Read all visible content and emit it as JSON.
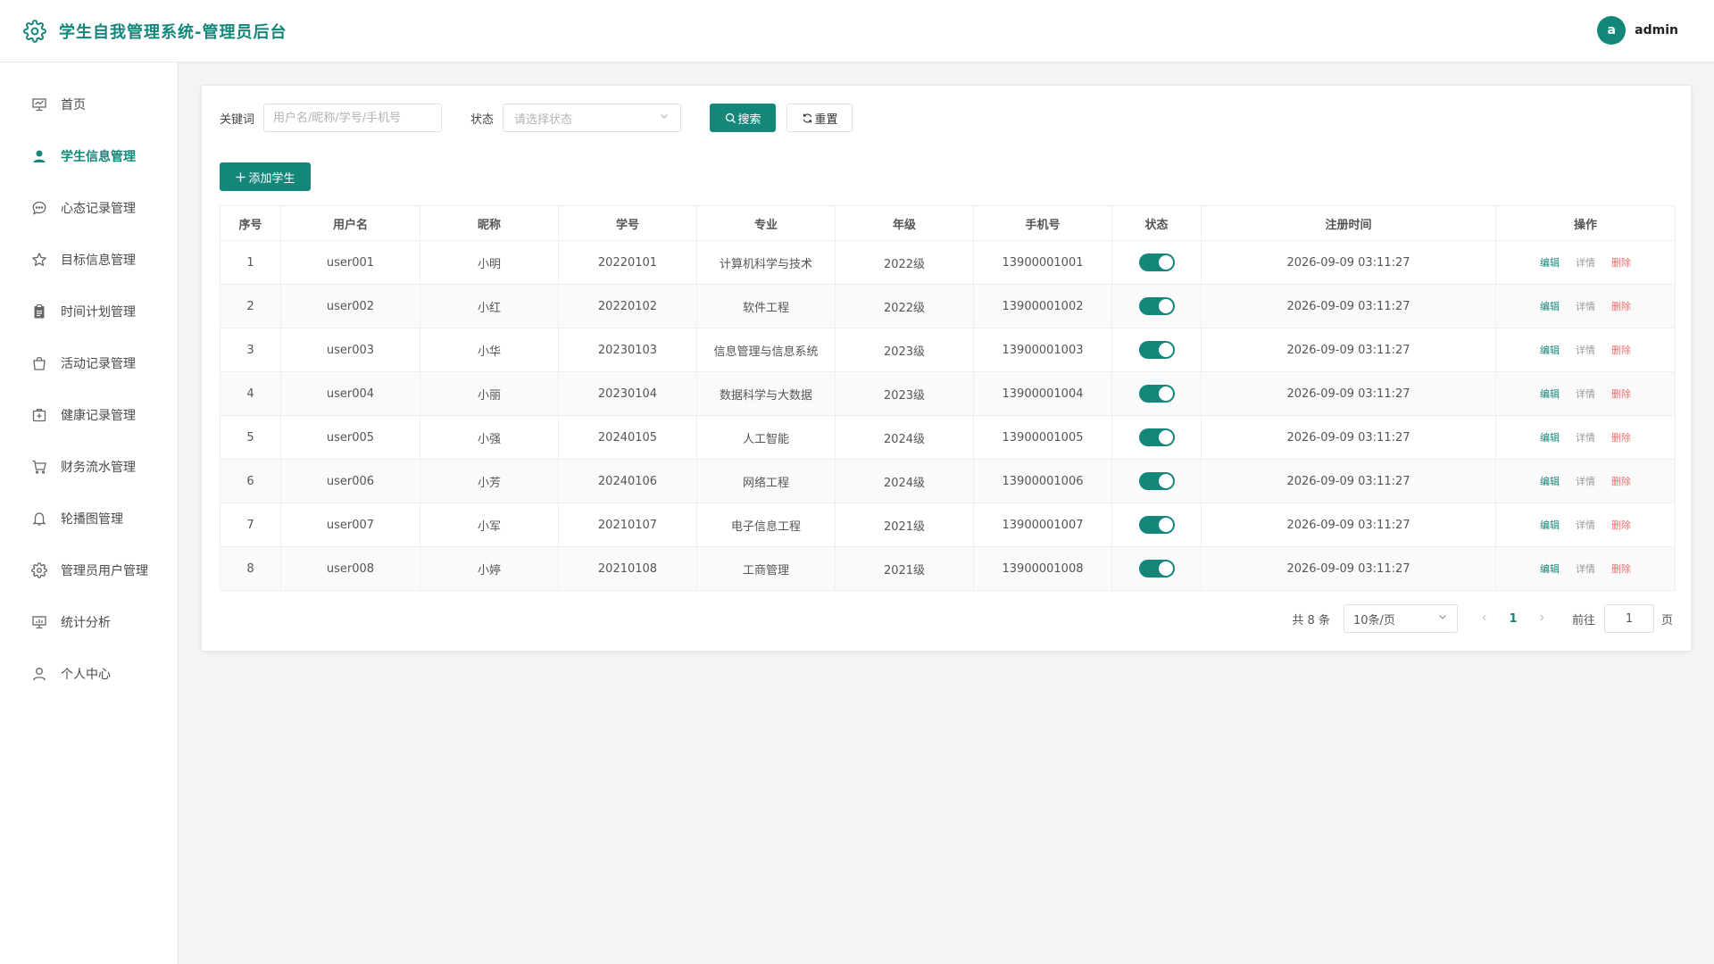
{
  "app": {
    "title": "学生自我管理系统-管理员后台",
    "brand_color": "#14877a"
  },
  "user": {
    "avatar_letter": "a",
    "name": "admin"
  },
  "sidebar": {
    "items": [
      {
        "label": "首页",
        "icon": "presentation-board-icon",
        "active": false
      },
      {
        "label": "学生信息管理",
        "icon": "user-icon",
        "active": true
      },
      {
        "label": "心态记录管理",
        "icon": "chat-bubble-icon",
        "active": false
      },
      {
        "label": "目标信息管理",
        "icon": "star-icon",
        "active": false
      },
      {
        "label": "时间计划管理",
        "icon": "clipboard-icon",
        "active": false
      },
      {
        "label": "活动记录管理",
        "icon": "shopping-bag-icon",
        "active": false
      },
      {
        "label": "健康记录管理",
        "icon": "first-aid-kit-icon",
        "active": false
      },
      {
        "label": "财务流水管理",
        "icon": "shopping-cart-icon",
        "active": false
      },
      {
        "label": "轮播图管理",
        "icon": "bell-icon",
        "active": false
      },
      {
        "label": "管理员用户管理",
        "icon": "gear-icon",
        "active": false
      },
      {
        "label": "统计分析",
        "icon": "chart-board-icon",
        "active": false
      },
      {
        "label": "个人中心",
        "icon": "user-outline-icon",
        "active": false
      }
    ]
  },
  "filters": {
    "keyword_label": "关键词",
    "keyword_placeholder": "用户名/昵称/学号/手机号",
    "status_label": "状态",
    "status_placeholder": "请选择状态",
    "search_label": "搜索",
    "reset_label": "重置"
  },
  "actions": {
    "add_label": "添加学生"
  },
  "table": {
    "columns": [
      "序号",
      "用户名",
      "昵称",
      "学号",
      "专业",
      "年级",
      "手机号",
      "状态",
      "注册时间",
      "操作"
    ],
    "op_labels": {
      "edit": "编辑",
      "detail": "详情",
      "delete": "删除"
    },
    "rows": [
      {
        "index": "1",
        "username": "user001",
        "nickname": "小明",
        "student_no": "20220101",
        "major": "计算机科学与技术",
        "grade": "2022级",
        "phone": "13900001001",
        "enabled": true,
        "registered": "2026-09-09 03:11:27"
      },
      {
        "index": "2",
        "username": "user002",
        "nickname": "小红",
        "student_no": "20220102",
        "major": "软件工程",
        "grade": "2022级",
        "phone": "13900001002",
        "enabled": true,
        "registered": "2026-09-09 03:11:27"
      },
      {
        "index": "3",
        "username": "user003",
        "nickname": "小华",
        "student_no": "20230103",
        "major": "信息管理与信息系统",
        "grade": "2023级",
        "phone": "13900001003",
        "enabled": true,
        "registered": "2026-09-09 03:11:27"
      },
      {
        "index": "4",
        "username": "user004",
        "nickname": "小丽",
        "student_no": "20230104",
        "major": "数据科学与大数据",
        "grade": "2023级",
        "phone": "13900001004",
        "enabled": true,
        "registered": "2026-09-09 03:11:27"
      },
      {
        "index": "5",
        "username": "user005",
        "nickname": "小强",
        "student_no": "20240105",
        "major": "人工智能",
        "grade": "2024级",
        "phone": "13900001005",
        "enabled": true,
        "registered": "2026-09-09 03:11:27"
      },
      {
        "index": "6",
        "username": "user006",
        "nickname": "小芳",
        "student_no": "20240106",
        "major": "网络工程",
        "grade": "2024级",
        "phone": "13900001006",
        "enabled": true,
        "registered": "2026-09-09 03:11:27"
      },
      {
        "index": "7",
        "username": "user007",
        "nickname": "小军",
        "student_no": "20210107",
        "major": "电子信息工程",
        "grade": "2021级",
        "phone": "13900001007",
        "enabled": true,
        "registered": "2026-09-09 03:11:27"
      },
      {
        "index": "8",
        "username": "user008",
        "nickname": "小婷",
        "student_no": "20210108",
        "major": "工商管理",
        "grade": "2021级",
        "phone": "13900001008",
        "enabled": true,
        "registered": "2026-09-09 03:11:27"
      }
    ]
  },
  "pagination": {
    "total_text": "共 8 条",
    "page_size": "10条/页",
    "current_page": "1",
    "goto_label": "前往",
    "goto_value": "1",
    "page_suffix": "页"
  }
}
